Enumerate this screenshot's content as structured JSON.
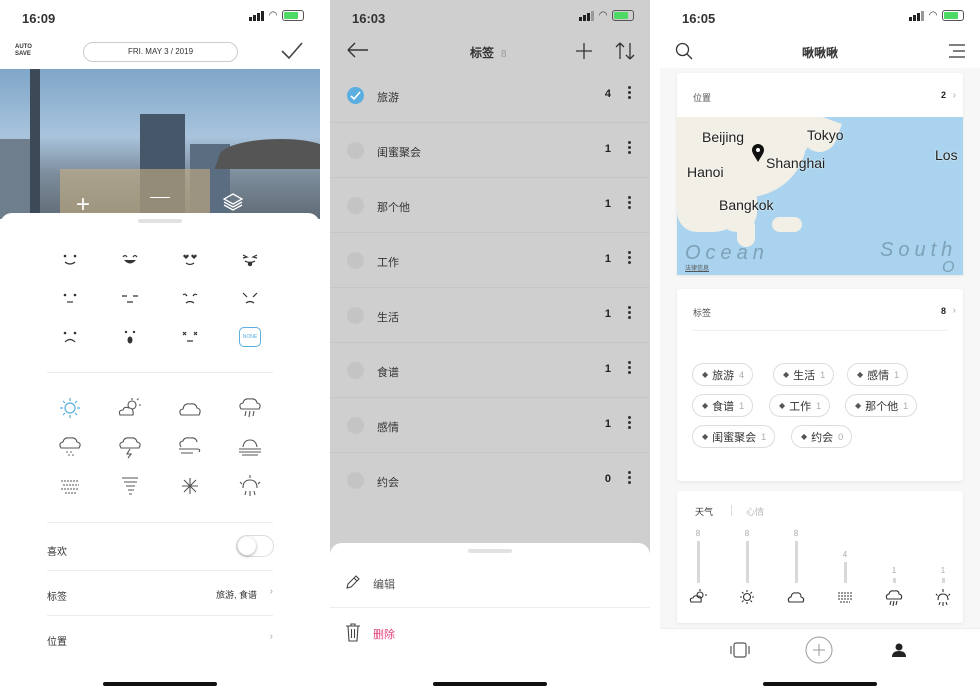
{
  "screen1": {
    "time": "16:09",
    "autosave": "AUTO SAVE",
    "date": "FRI. MAY 3 / 2019",
    "none_label": "NONE",
    "like_label": "喜欢",
    "tags_label": "标签",
    "tags_value": "旅游, 食谱",
    "location_label": "位置"
  },
  "screen2": {
    "time": "16:03",
    "title": "标签",
    "count": "8",
    "tags": [
      {
        "name": "旅游",
        "count": "4",
        "checked": true
      },
      {
        "name": "闺蜜聚会",
        "count": "1"
      },
      {
        "name": "那个他",
        "count": "1"
      },
      {
        "name": "工作",
        "count": "1"
      },
      {
        "name": "生活",
        "count": "1"
      },
      {
        "name": "食谱",
        "count": "1"
      },
      {
        "name": "感情",
        "count": "1"
      },
      {
        "name": "约会",
        "count": "0"
      }
    ],
    "edit_label": "编辑",
    "delete_label": "删除",
    "delete_color": "#e0407a",
    "check_color": "#5aaee0"
  },
  "screen3": {
    "time": "16:05",
    "title": "啾啾啾",
    "location": {
      "title": "位置",
      "count": "2"
    },
    "map": {
      "labels": [
        "Beijing",
        "Tokyo",
        "Shanghai",
        "Hanoi",
        "Bangkok",
        "Los"
      ],
      "ocean": "Ocean",
      "south": "South",
      "south2": "O",
      "legal": "法律信息"
    },
    "tags": {
      "title": "标签",
      "count": "8",
      "chips": [
        {
          "name": "旅游",
          "n": "4"
        },
        {
          "name": "生活",
          "n": "1"
        },
        {
          "name": "感情",
          "n": "1"
        },
        {
          "name": "食谱",
          "n": "1"
        },
        {
          "name": "工作",
          "n": "1"
        },
        {
          "name": "那个他",
          "n": "1"
        },
        {
          "name": "闺蜜聚会",
          "n": "1"
        },
        {
          "name": "约会",
          "n": "0"
        }
      ]
    },
    "stats": {
      "tab_weather": "天气",
      "tab_mood": "心情",
      "values": [
        {
          "n": "8",
          "icon": "sun-cloud-icon",
          "v": 8
        },
        {
          "n": "8",
          "icon": "sun-icon",
          "v": 8
        },
        {
          "n": "8",
          "icon": "cloud-icon",
          "v": 8
        },
        {
          "n": "4",
          "icon": "fog-icon",
          "v": 4
        },
        {
          "n": "1",
          "icon": "rain-icon",
          "v": 1
        },
        {
          "n": "1",
          "icon": "sunrise-icon",
          "v": 1
        }
      ]
    }
  }
}
